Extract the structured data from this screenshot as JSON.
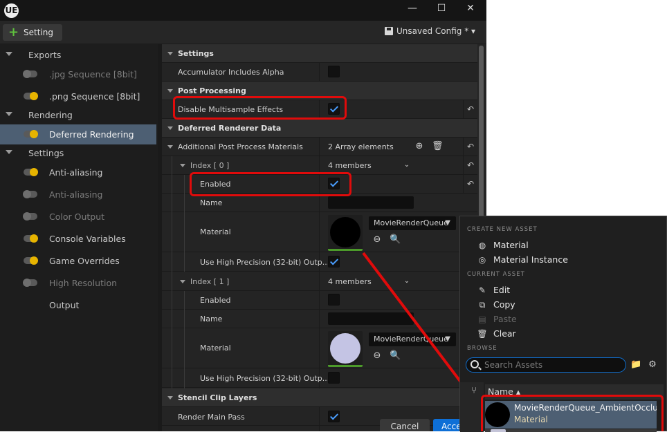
{
  "window": {
    "logo": "UE",
    "controls": {
      "minimize": "—",
      "maximize": "☐",
      "close": "✕"
    }
  },
  "toolbar": {
    "add_setting_label": "Setting",
    "config_label": "Unsaved Config * ▾"
  },
  "left_panel": {
    "exports_header": "Exports",
    "jpg_label": ".jpg Sequence [8bit]",
    "png_label": ".png Sequence [8bit]",
    "rendering_header": "Rendering",
    "deferred_label": "Deferred Rendering",
    "settings_header": "Settings",
    "anti_aliasing_1": "Anti-aliasing",
    "anti_aliasing_2": "Anti-aliasing",
    "color_output": "Color Output",
    "console_variables": "Console Variables",
    "game_overrides": "Game Overrides",
    "high_resolution": "High Resolution",
    "output": "Output"
  },
  "details": {
    "settings_cat": "Settings",
    "accumulator_label": "Accumulator Includes Alpha",
    "post_processing_cat": "Post Processing",
    "disable_msaa_label": "Disable Multisample Effects",
    "deferred_data_cat": "Deferred Renderer Data",
    "additional_ppm_label": "Additional Post Process Materials",
    "array_count": "2 Array elements",
    "index0_label": "Index [ 0 ]",
    "index0_members": "4 members",
    "enabled_label": "Enabled",
    "name_label": "Name",
    "material_label": "Material",
    "material0_value": "MovieRenderQueue",
    "high_precision_label": "Use High Precision (32-bit) Outp...",
    "index1_label": "Index [ 1 ]",
    "index1_members": "4 members",
    "enabled1_label": "Enabled",
    "name1_label": "Name",
    "material1_label": "Material",
    "material1_value": "MovieRenderQueue",
    "high_precision1_label": "Use High Precision (32-bit) Outp...",
    "stencil_cat": "Stencil Clip Layers",
    "render_main_pass_label": "Render Main Pass"
  },
  "footer": {
    "cancel": "Cancel",
    "accept": "Acce"
  },
  "asset_picker": {
    "create_header": "CREATE NEW ASSET",
    "material_item": "Material",
    "material_instance_item": "Material Instance",
    "current_header": "CURRENT ASSET",
    "edit_item": "Edit",
    "copy_item": "Copy",
    "paste_item": "Paste",
    "clear_item": "Clear",
    "browse_header": "BROWSE",
    "search_placeholder": "Search Assets",
    "name_column": "Name ▴",
    "asset_name": "MovieRenderQueue_AmbientOcclusion",
    "asset_type": "Material"
  },
  "colors": {
    "highlight": "#e00b0b",
    "selection": "#4d5f73",
    "accent_blue": "#0e6fd6",
    "toggle_on": "#e7b400"
  }
}
